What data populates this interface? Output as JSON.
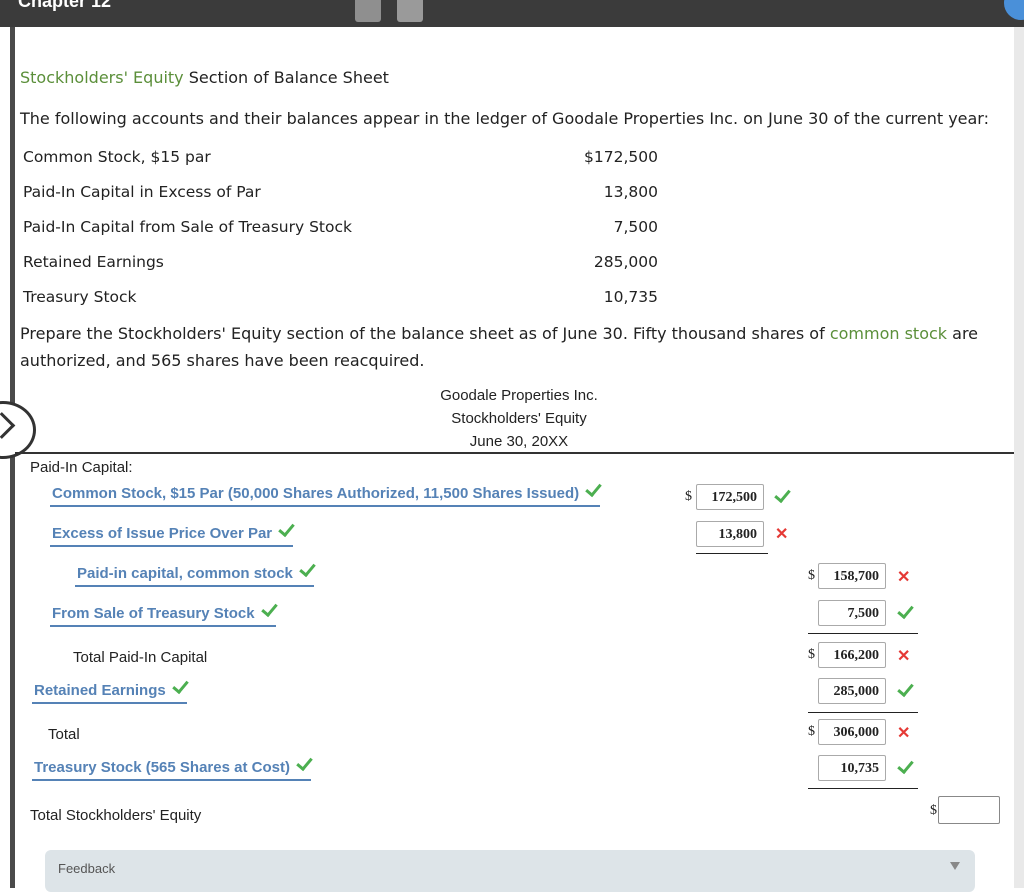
{
  "header": {
    "chapter": "Chapter 12"
  },
  "problem": {
    "title_link": "Stockholders' Equity",
    "title_rest": " Section of Balance Sheet",
    "intro": "The following accounts and their balances appear in the ledger of Goodale Properties Inc. on June 30 of the current year:",
    "ledger": [
      {
        "label": "Common Stock, $15 par",
        "value": "$172,500"
      },
      {
        "label": "Paid-In Capital in Excess of Par",
        "value": "13,800"
      },
      {
        "label": "Paid-In Capital from Sale of Treasury Stock",
        "value": "7,500"
      },
      {
        "label": "Retained Earnings",
        "value": "285,000"
      },
      {
        "label": "Treasury Stock",
        "value": "10,735"
      }
    ],
    "instruction_part1": "Prepare the Stockholders' Equity section of the balance sheet as of June 30. Fifty thousand shares of ",
    "instruction_link": "common stock",
    "instruction_part2": " are",
    "instruction_line2": "authorized, and 565 shares have been reacquired."
  },
  "statement": {
    "company": "Goodale Properties Inc.",
    "title": "Stockholders' Equity",
    "date": "June 30, 20XX",
    "paid_in_label": "Paid-In Capital:",
    "common_stock_select": "Common Stock, $15 Par (50,000 Shares Authorized, 11,500 Shares Issued)",
    "common_stock_value": "172,500",
    "excess_select": "Excess of Issue Price Over Par",
    "excess_value": "13,800",
    "pic_common_select": "Paid-in capital, common stock",
    "pic_common_value": "158,700",
    "treasury_sale_select": "From Sale of Treasury Stock",
    "treasury_sale_value": "7,500",
    "total_paid_in_label": "Total Paid-In Capital",
    "total_paid_in_value": "166,200",
    "retained_select": "Retained Earnings",
    "retained_value": "285,000",
    "total_label": "Total",
    "total_value": "306,000",
    "treasury_select": "Treasury Stock (565 Shares at Cost)",
    "treasury_value": "10,735",
    "total_equity_label": "Total Stockholders' Equity",
    "total_equity_value": "",
    "dollar_sign": "$"
  },
  "feedback": {
    "label": "Feedback"
  },
  "colors": {
    "link_green": "#5b8f3a",
    "select_blue": "#5582b6",
    "correct": "#4caf50",
    "incorrect": "#e53935"
  }
}
